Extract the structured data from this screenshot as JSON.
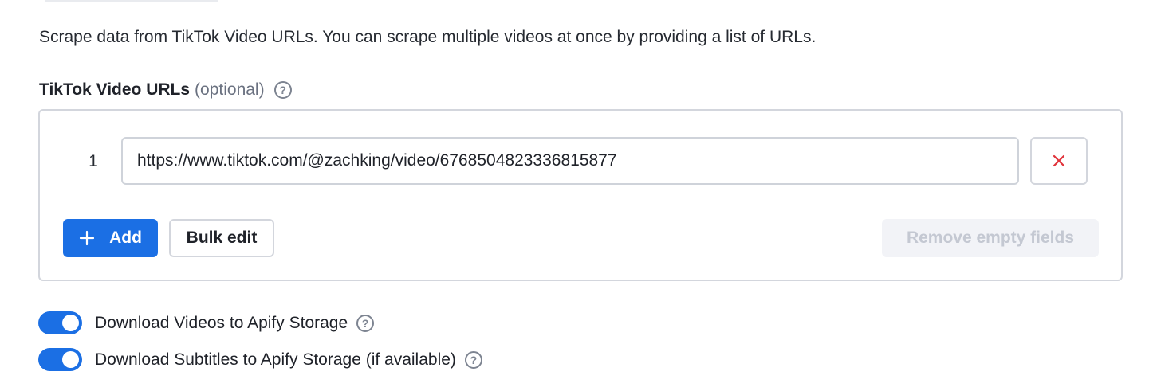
{
  "description": "Scrape data from TikTok Video URLs. You can scrape multiple videos at once by providing a list of URLs.",
  "field": {
    "label": "TikTok Video URLs",
    "optional_label": "(optional)",
    "help_icon": "question-circle-icon"
  },
  "url_list": {
    "rows": [
      {
        "index": "1",
        "value": "https://www.tiktok.com/@zachking/video/6768504823336815877",
        "delete_icon": "close-x-icon"
      }
    ],
    "add_label": "Add",
    "add_icon": "plus-icon",
    "bulk_edit_label": "Bulk edit",
    "remove_empty_label": "Remove empty fields"
  },
  "toggles": [
    {
      "label": "Download Videos to Apify Storage",
      "checked": true,
      "help_icon": "question-circle-icon"
    },
    {
      "label": "Download Subtitles to Apify Storage (if available)",
      "checked": true,
      "help_icon": "question-circle-icon"
    }
  ],
  "colors": {
    "accent": "#1b6fe4",
    "danger": "#e0333a",
    "muted_text": "#6a7180"
  }
}
